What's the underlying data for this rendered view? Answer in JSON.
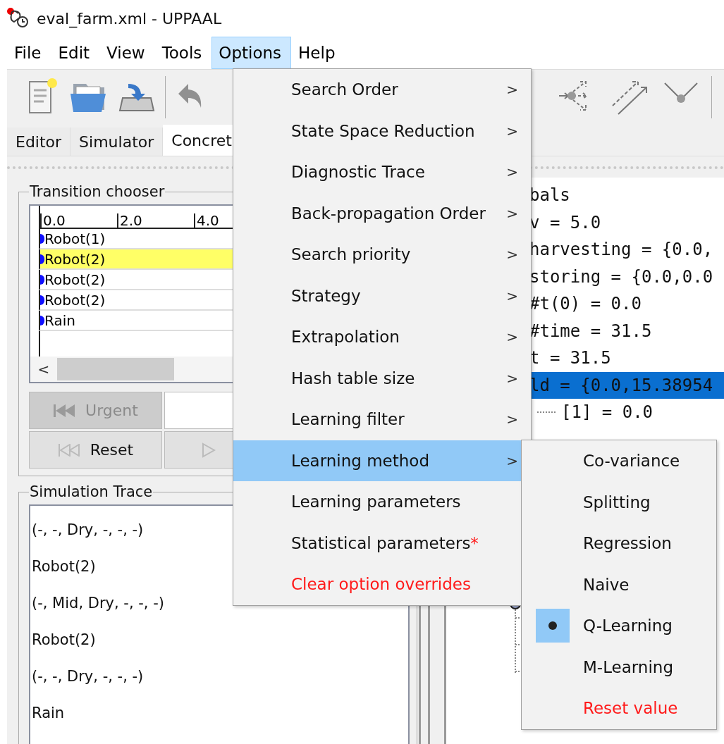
{
  "window": {
    "title": "eval_farm.xml - UPPAAL"
  },
  "menubar": [
    {
      "label": "File",
      "selected": false
    },
    {
      "label": "Edit",
      "selected": false
    },
    {
      "label": "View",
      "selected": false
    },
    {
      "label": "Tools",
      "selected": false
    },
    {
      "label": "Options",
      "selected": true
    },
    {
      "label": "Help",
      "selected": false
    }
  ],
  "tabs": [
    {
      "label": "Editor",
      "selected": false
    },
    {
      "label": "Simulator",
      "selected": false
    },
    {
      "label": "Concret",
      "selected": true
    }
  ],
  "transition_chooser": {
    "title": "Transition chooser",
    "ruler": [
      "0.0",
      "2.0",
      "4.0"
    ],
    "rows": [
      {
        "label": "Robot(1)",
        "selected": false
      },
      {
        "label": "Robot(2)",
        "selected": true
      },
      {
        "label": "Robot(2)",
        "selected": false
      },
      {
        "label": "Robot(2)",
        "selected": false
      },
      {
        "label": "Rain",
        "selected": false
      }
    ],
    "scroll_left": "<",
    "buttons": [
      {
        "label": "Urgent",
        "disabled": true,
        "kind": "urgent"
      },
      {
        "label": "Reset",
        "disabled": false,
        "kind": "reset"
      }
    ]
  },
  "simulation_trace": {
    "title": "Simulation Trace",
    "entries": [
      "(-, -, Dry, -, -, -)",
      "Robot(2)",
      "(-, Mid, Dry, -, -, -)",
      "Robot(2)",
      "(-, -, Dry, -, -, -)",
      "Rain"
    ]
  },
  "variables": [
    {
      "text": "bals",
      "selected": false
    },
    {
      "text": "v = 5.0",
      "selected": false
    },
    {
      "text": "harvesting = {0.0,",
      "selected": false
    },
    {
      "text": "storing = {0.0,0.0",
      "selected": false
    },
    {
      "text": "#t(0) = 0.0",
      "selected": false
    },
    {
      "text": "#time = 31.5",
      "selected": false
    },
    {
      "text": "t = 31.5",
      "selected": false
    },
    {
      "text": "ld = {0.0,15.38954",
      "selected": true,
      "children": [
        {
          "text": "[1] = 0.0",
          "selected": false
        }
      ]
    }
  ],
  "options_menu": [
    {
      "label": "Search Order",
      "kind": "submenu",
      "selected": false
    },
    {
      "label": "State Space Reduction",
      "kind": "submenu",
      "selected": false
    },
    {
      "label": "Diagnostic Trace",
      "kind": "submenu",
      "selected": false
    },
    {
      "label": "Back-propagation Order",
      "kind": "submenu",
      "selected": false
    },
    {
      "label": "Search priority",
      "kind": "submenu",
      "selected": false
    },
    {
      "label": "Strategy",
      "kind": "submenu",
      "selected": false
    },
    {
      "label": "Extrapolation",
      "kind": "submenu",
      "selected": false
    },
    {
      "label": "Hash table size",
      "kind": "submenu",
      "selected": false
    },
    {
      "label": "Learning filter",
      "kind": "submenu",
      "selected": false
    },
    {
      "label": "Learning method",
      "kind": "submenu",
      "selected": true
    },
    {
      "label": "Learning parameters",
      "kind": "action",
      "selected": false
    },
    {
      "label": "Statistical parameters",
      "marker": "*",
      "kind": "action",
      "selected": false
    },
    {
      "label": "Clear option overrides",
      "kind": "reset",
      "selected": false
    }
  ],
  "submenu_arrow": ">",
  "learning_method_menu": [
    {
      "label": "Co-variance",
      "kind": "option",
      "selected": false
    },
    {
      "label": "Splitting",
      "kind": "option",
      "selected": false
    },
    {
      "label": "Regression",
      "kind": "option",
      "selected": false
    },
    {
      "label": "Naive",
      "kind": "option",
      "selected": false
    },
    {
      "label": "Q-Learning",
      "kind": "option",
      "selected": true
    },
    {
      "label": "M-Learning",
      "kind": "option",
      "selected": false
    },
    {
      "label": "Reset value",
      "kind": "reset",
      "selected": false
    }
  ]
}
